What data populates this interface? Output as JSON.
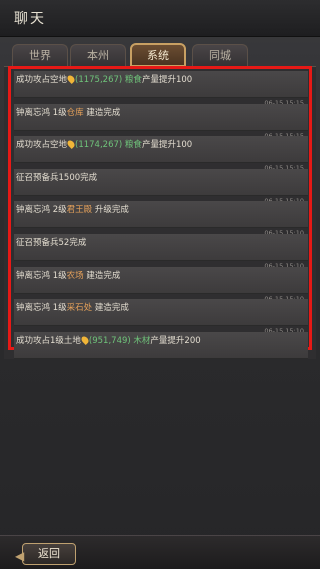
{
  "title": "聊天",
  "tabs": [
    {
      "label": "世界"
    },
    {
      "label": "本州"
    },
    {
      "label": "系统"
    },
    {
      "label": "同城"
    }
  ],
  "messages": [
    {
      "parts": [
        {
          "t": "成功攻占空地"
        },
        {
          "pin": true
        },
        {
          "t": "(1175,267) ",
          "c": "green"
        },
        {
          "t": "粮食",
          "c": "green"
        },
        {
          "t": "产量提升100"
        }
      ],
      "time": "06-15 15:15"
    },
    {
      "parts": [
        {
          "t": "钟离忘鸿 1级"
        },
        {
          "t": "仓库",
          "c": "orange"
        },
        {
          "t": " 建造完成"
        }
      ],
      "time": "06-15 15:15"
    },
    {
      "parts": [
        {
          "t": "成功攻占空地"
        },
        {
          "pin": true
        },
        {
          "t": "(1174,267) ",
          "c": "green"
        },
        {
          "t": "粮食",
          "c": "green"
        },
        {
          "t": "产量提升100"
        }
      ],
      "time": "06-15 15:15"
    },
    {
      "parts": [
        {
          "t": "征召预备兵1500完成"
        }
      ],
      "time": "06-15 15:10"
    },
    {
      "parts": [
        {
          "t": "钟离忘鸿 2级"
        },
        {
          "t": "君王殿",
          "c": "orange"
        },
        {
          "t": " 升级完成"
        }
      ],
      "time": "06-15 15:10"
    },
    {
      "parts": [
        {
          "t": "征召预备兵52完成"
        }
      ],
      "time": "06-15 15:10"
    },
    {
      "parts": [
        {
          "t": "钟离忘鸿 1级"
        },
        {
          "t": "农场",
          "c": "orange"
        },
        {
          "t": " 建造完成"
        }
      ],
      "time": "06-15 15:10"
    },
    {
      "parts": [
        {
          "t": "钟离忘鸿 1级"
        },
        {
          "t": "采石处",
          "c": "orange"
        },
        {
          "t": " 建造完成"
        }
      ],
      "time": "06-15 15:10"
    },
    {
      "parts": [
        {
          "t": "成功攻占1级土地"
        },
        {
          "pin": true
        },
        {
          "t": "(951,749) ",
          "c": "green"
        },
        {
          "t": "木材",
          "c": "green"
        },
        {
          "t": "产量提升200"
        }
      ],
      "time": ""
    }
  ],
  "back_label": "返回"
}
